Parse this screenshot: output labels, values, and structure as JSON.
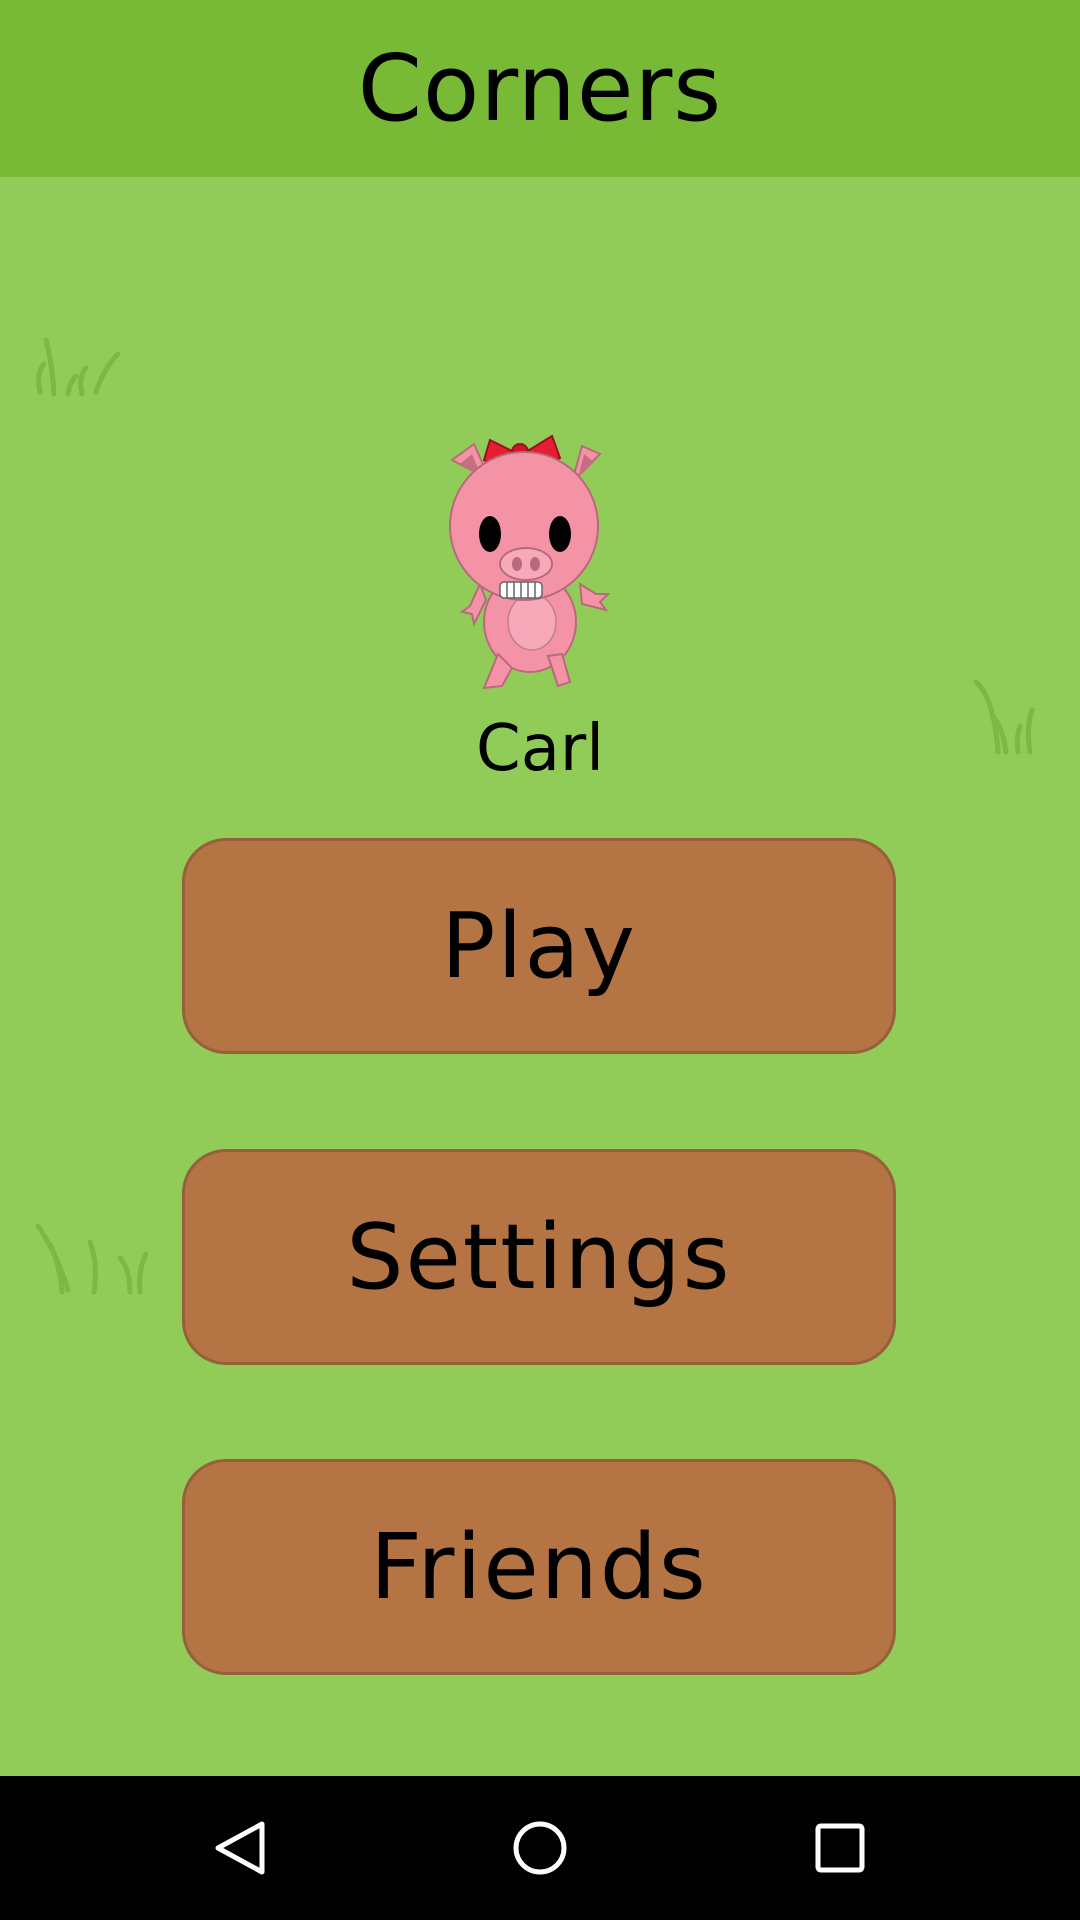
{
  "app_bar": {
    "title": "Corners"
  },
  "player": {
    "name": "Carl",
    "avatar_icon": "pig-character"
  },
  "menu": {
    "play_label": "Play",
    "settings_label": "Settings",
    "friends_label": "Friends"
  },
  "colors": {
    "app_bar": "#78b935",
    "background": "#92cc58",
    "button_fill": "#b47443",
    "button_border": "#95603a",
    "nav_bar": "#000000"
  },
  "nav_bar": {
    "back_icon": "triangle-back-icon",
    "home_icon": "circle-home-icon",
    "recents_icon": "square-recents-icon"
  }
}
